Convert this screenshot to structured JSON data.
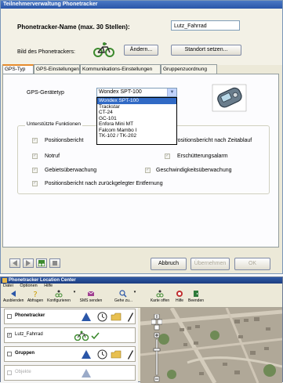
{
  "window1": {
    "title": "Teilnehmerverwaltung Phonetracker",
    "name_label": "Phonetracker-Name (max. 30 Stellen):",
    "name_value": "Lutz_Fahrrad",
    "picture_label": "Bild des Phonetrackers:",
    "change_button": "Ändern...",
    "location_button": "Standort setzen...",
    "tabs": [
      "GPS-Typ",
      "GPS-Einstellungen",
      "Kommunikations-Einstellungen",
      "Gruppenzuordnung"
    ],
    "active_tab": "GPS-Typ",
    "gps_device_label": "GPS-Gerätetyp",
    "gps_device_selected": "Wondex SPT-100",
    "gps_device_options": [
      "Wondex SPT-100",
      "Trackstar",
      "CT-24",
      "GC-101",
      "Enfora Mini MT",
      "Falcom Mambo I",
      "TK-102 / TK-202"
    ],
    "functions_group_label": "Unterstützte Funktionen",
    "functions": {
      "positionsbericht_left": "Positionsbericht",
      "zeitablauf": "Positionsbericht nach Zeitablauf",
      "notruf": "Notruf",
      "erschuetterungsalarm": "Erschütterungsalarm",
      "gebietsueberwachung": "Gebietsüberwachung",
      "geschwindigkeit": "Geschwindigkeitsüberwachung",
      "entfernung": "Positionsbericht nach zurückgelegter Entfernung"
    },
    "cancel_button": "Abbruch",
    "apply_button": "Übernehmen",
    "ok_button": "OK"
  },
  "window2": {
    "title": "Phonetracker Location Center",
    "menu": [
      "Datei",
      "Optionen",
      "Hilfe"
    ],
    "toolbar": [
      "Ausblenden",
      "Abfragen",
      "Konfigurieren",
      "SMS senden",
      "Gehe zu...",
      "Karte offen",
      "Hilfe",
      "Beenden"
    ],
    "list_rows": [
      {
        "label": "Phonetracker",
        "checked": false,
        "disabled": false
      },
      {
        "label": "Lutz_Fahrrad",
        "checked": true,
        "disabled": false
      },
      {
        "label": "Gruppen",
        "checked": false,
        "disabled": false
      },
      {
        "label": "Objekte",
        "checked": false,
        "disabled": true
      }
    ]
  },
  "colors": {
    "title_blue": "#2a56a8",
    "tab_orange": "#e68b2c",
    "select_blue": "#316ac5",
    "bike_green": "#3c8a2e"
  }
}
